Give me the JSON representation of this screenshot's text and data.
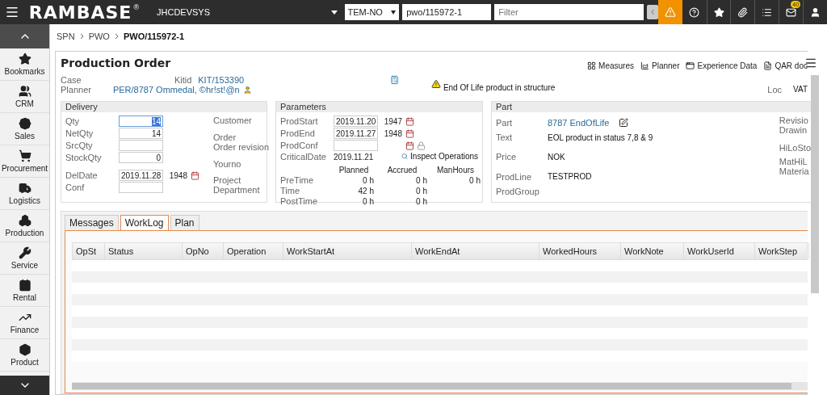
{
  "top_bar": {
    "logo": "RAMBASE",
    "logo_mark": "®",
    "company": "JHCDEVSYS",
    "locale": "TEM-NO",
    "search_value": "pwo/115972-1",
    "filter_placeholder": "Filter",
    "mail_count": "40"
  },
  "sidebar": {
    "items": [
      {
        "label": "Bookmarks"
      },
      {
        "label": "CRM"
      },
      {
        "label": "Sales"
      },
      {
        "label": "Procurement"
      },
      {
        "label": "Logistics"
      },
      {
        "label": "Production"
      },
      {
        "label": "Service"
      },
      {
        "label": "Rental"
      },
      {
        "label": "Finance"
      },
      {
        "label": "Product"
      }
    ]
  },
  "breadcrumb": [
    "SPN",
    "PWO",
    "PWO/115972-1"
  ],
  "page": {
    "title": "Production Order",
    "links": [
      "Measures",
      "Planner",
      "Experience Data",
      "QAR doc"
    ],
    "case_label": "Case",
    "kitid_label": "Kitid",
    "kitid_value": "KIT/153390",
    "planner_label": "Planner",
    "planner_value": "PER/8787 Ommedal, ©hr!st!@n",
    "warning": "End Of Life product in structure",
    "loc_label": "Loc",
    "loc_value": "VAT"
  },
  "delivery": {
    "title": "Delivery",
    "fields": [
      {
        "label": "Qty",
        "value": "14",
        "selected": true
      },
      {
        "label": "NetQty",
        "value": "14",
        "selected": false
      },
      {
        "label": "SrcQty",
        "selected": false
      },
      {
        "label": "StockQty",
        "value": "0",
        "selected": false
      }
    ],
    "del_date": {
      "label": "DelDate",
      "value": "2019.11.28",
      "week": "1948"
    },
    "conf_label": "Conf",
    "right_labels": [
      "Customer",
      "Order",
      "Order revision",
      "Yourno",
      "Project",
      "Department"
    ]
  },
  "parameters": {
    "title": "Parameters",
    "dates": [
      {
        "label": "ProdStart",
        "value": "2019.11.20",
        "week": "1947"
      },
      {
        "label": "ProdEnd",
        "value": "2019.11.27",
        "week": "1948"
      },
      {
        "label": "ProdConf"
      }
    ],
    "critical_label": "CriticalDate",
    "critical_value": "2019.11.21",
    "inspect_link": "Inspect Operations",
    "time_headers": [
      "Planned",
      "Accrued",
      "ManHours"
    ],
    "time_rows": [
      {
        "label": "PreTime",
        "planned": "0 h",
        "accrued": "0 h",
        "manhours": "0 h"
      },
      {
        "label": "Time",
        "planned": "42 h",
        "accrued": "0 h"
      },
      {
        "label": "PostTime",
        "planned": "0 h",
        "accrued": "0 h"
      }
    ]
  },
  "part": {
    "title": "Part",
    "part_label": "Part",
    "part_value": "8787 EndOfLife",
    "text_label": "Text",
    "text_value": "EOL product in status 7,8 & 9",
    "price_label": "Price",
    "price_value": "NOK",
    "prodline_label": "ProdLine",
    "prodline_value": "TESTPROD",
    "prodgroup_label": "ProdGroup",
    "right_labels": [
      "Revisio",
      "Drawin",
      "HiLoSto",
      "MatHiL",
      "Materia"
    ]
  },
  "tabs": [
    {
      "label": "Messages",
      "selected": false
    },
    {
      "label": "WorkLog",
      "selected": true
    },
    {
      "label": "Plan",
      "selected": false
    }
  ],
  "table": {
    "columns": [
      "OpSt",
      "Status",
      "OpNo",
      "Operation",
      "WorkStartAt",
      "WorkEndAt",
      "WorkedHours",
      "WorkNote",
      "WorkUserId",
      "WorkStep"
    ]
  }
}
